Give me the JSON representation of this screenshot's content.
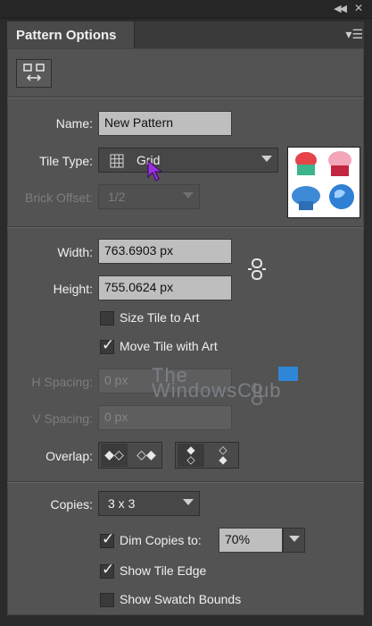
{
  "window": {
    "collapse_icon": "double-chevron-left-icon",
    "close_icon": "close-icon"
  },
  "tab": {
    "title": "Pattern Options",
    "menu_icon": "panel-menu-icon"
  },
  "toolbar": {
    "fit_icon": "pattern-tile-tool-icon"
  },
  "form": {
    "name": {
      "label": "Name:",
      "value": "New Pattern"
    },
    "tile_type": {
      "label": "Tile Type:",
      "value": "Grid",
      "icon": "grid-icon"
    },
    "brick_offset": {
      "label": "Brick Offset:",
      "value": "1/2"
    },
    "width": {
      "label": "Width:",
      "value": "763.6903 px"
    },
    "height": {
      "label": "Height:",
      "value": "755.0624 px"
    },
    "size_tile_to_art": {
      "label": "Size Tile to Art",
      "checked": false
    },
    "move_tile_with_art": {
      "label": "Move Tile with Art",
      "checked": true
    },
    "h_spacing": {
      "label": "H Spacing:",
      "value": "0 px"
    },
    "v_spacing": {
      "label": "V Spacing:",
      "value": "0 px"
    },
    "overlap": {
      "label": "Overlap:"
    },
    "copies": {
      "label": "Copies:",
      "value": "3 x 3"
    },
    "dim_copies": {
      "label": "Dim Copies to:",
      "checked": true,
      "value": "70%"
    },
    "show_tile_edge": {
      "label": "Show Tile Edge",
      "checked": true
    },
    "show_swatch_bounds": {
      "label": "Show Swatch Bounds",
      "checked": false
    }
  },
  "watermark": {
    "line1": "The",
    "line2": "WindowsClub"
  },
  "colors": {
    "panel": "#535353",
    "field": "#bebebe",
    "cursor": "#8a2be2"
  }
}
